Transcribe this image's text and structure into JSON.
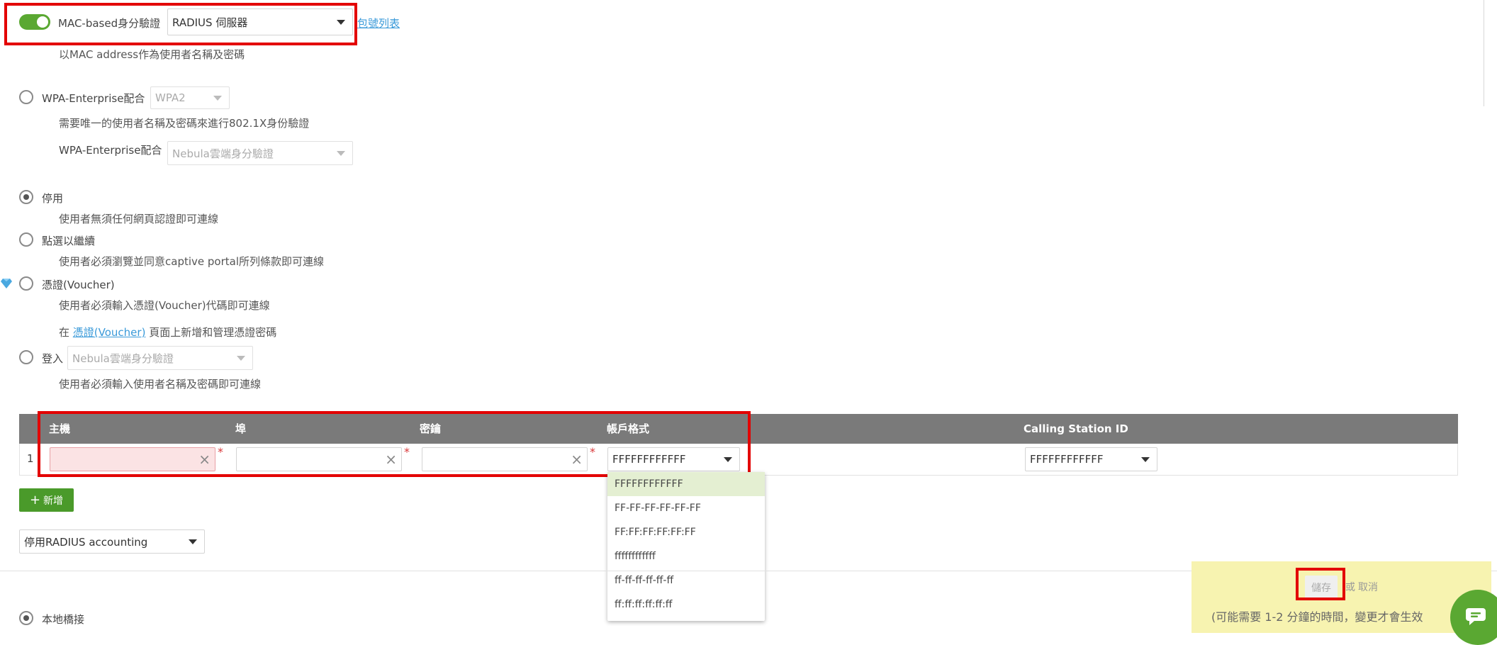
{
  "mac_auth": {
    "label": "MAC-based身分驗證",
    "select_value": "RADIUS 伺服器",
    "link_text": "包號列表",
    "desc": "以MAC address作為使用者名稱及密碼",
    "toggle_on": true,
    "toggle_color": "#5aa832"
  },
  "wpa": {
    "label": "WPA-Enterprise配合",
    "select_value": "WPA2",
    "desc": "需要唯一的使用者名稱及密碼來進行802.1X身份驗證",
    "sub_label": "WPA-Enterprise配合",
    "sub_select_value": "Nebula雲端身分驗證"
  },
  "portal": {
    "disable_label": "停用",
    "disable_desc": "使用者無須任何網頁認證即可連線",
    "click_label": "點選以繼續",
    "click_desc": "使用者必須瀏覽並同意captive portal所列條款即可連線",
    "voucher_label": "憑證(Voucher)",
    "voucher_desc": "使用者必須輸入憑證(Voucher)代碼即可連線",
    "voucher_note_prefix": "在",
    "voucher_note_link": "憑證(Voucher)",
    "voucher_note_suffix": "頁面上新增和管理憑證密碼",
    "login_label": "登入",
    "login_select_value": "Nebula雲端身分驗證",
    "login_desc": "使用者必須輸入使用者名稱及密碼即可連線"
  },
  "radius_table": {
    "headers": {
      "host": "主機",
      "port": "埠",
      "secret": "密鑰",
      "account_format": "帳戶格式",
      "calling_station": "Calling Station ID"
    },
    "row_index": "1",
    "account_format_value": "FFFFFFFFFFFF",
    "calling_station_value": "FFFFFFFFFFFF",
    "header_bg": "#7a7a7a"
  },
  "dropdown_options": [
    "FFFFFFFFFFFF",
    "FF-FF-FF-FF-FF-FF",
    "FF:FF:FF:FF:FF:FF",
    "ffffffffffff",
    "ff-ff-ff-ff-ff-ff",
    "ff:ff:ff:ff:ff:ff"
  ],
  "add_button": {
    "label": "新增",
    "color": "#4a9a2a"
  },
  "accounting_select": "停用RADIUS accounting",
  "local_bridge_label": "本地橋接",
  "save_bar": {
    "save_label": "儲存",
    "or_label": "或",
    "cancel_label": "取消",
    "note": "(可能需要 1-2 分鐘的時間，變更才會生效",
    "bg": "#f7f3b0"
  },
  "chat_color": "#5aa832"
}
